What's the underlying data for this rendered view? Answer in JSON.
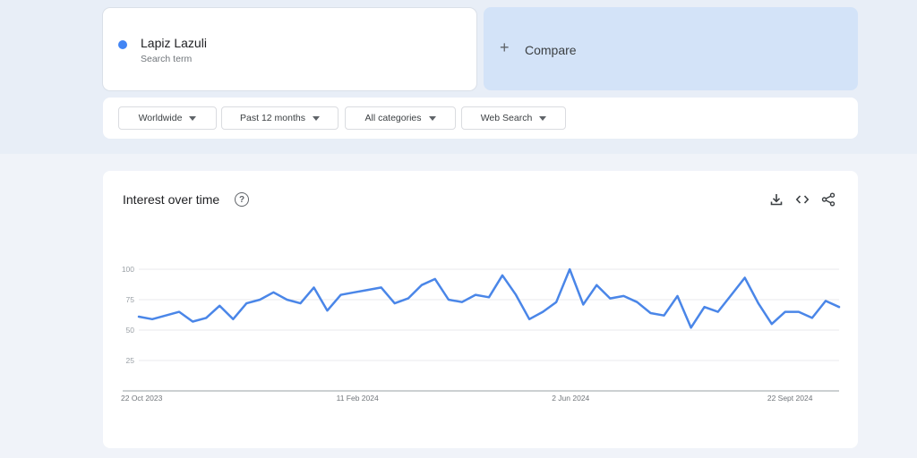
{
  "search_term": {
    "name": "Lapiz Lazuli",
    "subtitle": "Search term",
    "color": "#4285f4"
  },
  "compare": {
    "label": "Compare",
    "background": "#d3e3f8"
  },
  "filters": [
    {
      "label": "Worldwide"
    },
    {
      "label": "Past 12 months"
    },
    {
      "label": "All categories"
    },
    {
      "label": "Web Search"
    }
  ],
  "chart_section": {
    "title": "Interest over time",
    "icons": [
      "help-icon",
      "download-icon",
      "embed-code-icon",
      "share-icon"
    ]
  },
  "chart_data": {
    "type": "line",
    "x_tick_labels": [
      "22 Oct 2023",
      "11 Feb 2024",
      "2 Jun 2024",
      "22 Sept 2024"
    ],
    "x_tick_indices": [
      0,
      16,
      32,
      48
    ],
    "y_ticks": [
      25,
      50,
      75,
      100
    ],
    "ylim": [
      0,
      100
    ],
    "grid": true,
    "series": [
      {
        "color": "#4a86e8",
        "values": [
          61,
          59,
          62,
          65,
          57,
          60,
          70,
          59,
          72,
          75,
          81,
          75,
          72,
          85,
          66,
          79,
          81,
          83,
          85,
          72,
          76,
          87,
          92,
          75,
          73,
          79,
          77,
          95,
          79,
          59,
          65,
          73,
          100,
          71,
          87,
          76,
          78,
          73,
          64,
          62,
          78,
          52,
          69,
          65,
          79,
          93,
          72,
          55,
          65,
          65,
          60,
          74,
          69
        ]
      }
    ]
  }
}
